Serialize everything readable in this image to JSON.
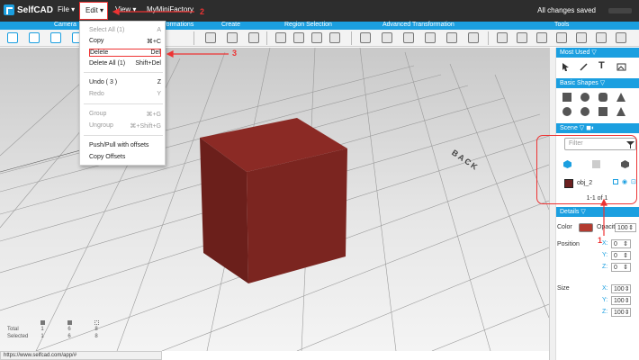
{
  "app": {
    "title": "SelfCAD"
  },
  "menu": {
    "file": "File",
    "edit": "Edit",
    "view": "View",
    "project": "MyMiniFactory"
  },
  "status": {
    "saved": "All changes saved"
  },
  "sections": [
    "Camera",
    "Transformations",
    "Create",
    "Region Selection",
    "Advanced Transformation",
    "Tools"
  ],
  "edit_menu": {
    "items": [
      {
        "label": "Select All (1)",
        "shortcut": "A"
      },
      {
        "label": "Copy",
        "shortcut": "⌘+C"
      },
      {
        "label": "Delete",
        "shortcut": "Del"
      },
      {
        "label": "Delete All (1)",
        "shortcut": "Shift+Del"
      },
      {
        "label": "Undo  ( 3 )",
        "shortcut": "Z"
      },
      {
        "label": "Redo",
        "shortcut": "Y"
      },
      {
        "label": "Group",
        "shortcut": "⌘+G"
      },
      {
        "label": "Ungroup",
        "shortcut": "⌘+Shift+G"
      },
      {
        "label": "Push/Pull with offsets",
        "shortcut": ""
      },
      {
        "label": "Copy Offsets",
        "shortcut": ""
      }
    ]
  },
  "viewport": {
    "back_label": "BACK"
  },
  "stats": {
    "total_label": "Total",
    "selected_label": "Selected",
    "total": [
      "1",
      "6",
      "8"
    ],
    "selected": [
      "1",
      "6",
      "8"
    ]
  },
  "statusbar": {
    "url": "https://www.selfcad.com/app/#"
  },
  "panel": {
    "most_used": "Most Used",
    "basic_shapes": "Basic Shapes",
    "scene": "Scene",
    "filter_placeholder": "Filter",
    "object_name": "obj_2",
    "pager": "1-1 of 1",
    "details": "Details",
    "color_label": "Color",
    "opacity_label": "Opacity",
    "opacity_value": "100",
    "position_label": "Position",
    "size_label": "Size",
    "position": {
      "x": "0",
      "y": "0",
      "z": "0"
    },
    "size": {
      "x": "100",
      "y": "100",
      "z": "100"
    }
  },
  "annotations": {
    "one": "1",
    "two": "2",
    "three": "3"
  },
  "colors": {
    "accent": "#1b9fe0",
    "topbar": "#2d2d2d",
    "cube": "#8b2a25",
    "annotation": "#e33333"
  }
}
